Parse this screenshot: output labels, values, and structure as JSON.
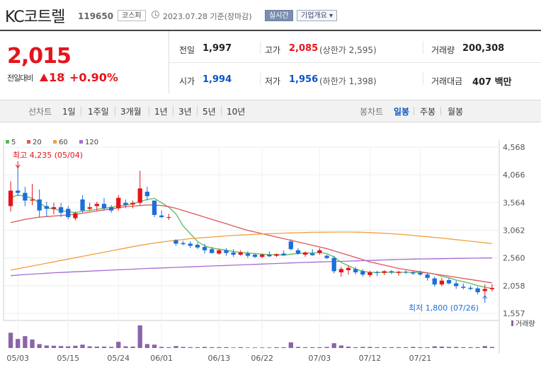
{
  "header": {
    "name": "KC코트렐",
    "code": "119650",
    "market": "코스피",
    "date": "2023.07.28",
    "basis": "기준(장마감)",
    "live_label": "실시간",
    "info_label": "기업개요 ▾"
  },
  "price": {
    "current": "2,015",
    "change_label": "전일대비",
    "change": "18",
    "change_pct": "+0.90%",
    "direction": "up"
  },
  "stats": {
    "prev_label": "전일",
    "prev": "1,997",
    "high_label": "고가",
    "high": "2,085",
    "upper_limit": "(상한가 2,595)",
    "volume_label": "거래량",
    "volume": "200,308",
    "open_label": "시가",
    "open": "1,994",
    "low_label": "저가",
    "low": "1,956",
    "lower_limit": "(하한가 1,398)",
    "amount_label": "거래대금",
    "amount": "407 백만"
  },
  "toolbar": {
    "line_label": "선차트",
    "line_periods": [
      "1일",
      "1주일",
      "3개월",
      "1년",
      "3년",
      "5년",
      "10년"
    ],
    "selected_line_period": "3개월",
    "candle_label": "봉차트",
    "candle_periods": [
      "일봉",
      "주봉",
      "월봉"
    ],
    "selected_candle_period": "일봉"
  },
  "colors": {
    "up": "#e5141b",
    "down": "#1c6fd8",
    "ma5": "#5cb85c",
    "ma20": "#e0545b",
    "ma60": "#f0a040",
    "ma120": "#a66bd1",
    "volume": "#8b64a8"
  },
  "chart_data": {
    "type": "candlestick",
    "moving_average_legend": [
      "5",
      "20",
      "60",
      "120"
    ],
    "yticks": [
      "4,568",
      "4,066",
      "3,564",
      "3,062",
      "2,560",
      "2,058",
      "1,557"
    ],
    "ylim": [
      1557,
      4568
    ],
    "xticks": [
      "05/03",
      "05/15",
      "05/24",
      "06/01",
      "06/13",
      "06/22",
      "07/03",
      "07/12",
      "07/21"
    ],
    "high_annotation": "최고 4,235 (05/04)",
    "low_annotation": "최저 1,800 (07/26)",
    "volume_label": "거래량",
    "candles": [
      {
        "o": 3500,
        "h": 3950,
        "l": 3400,
        "c": 3780
      },
      {
        "o": 3780,
        "h": 4235,
        "l": 3680,
        "c": 3740
      },
      {
        "o": 3740,
        "h": 3850,
        "l": 3500,
        "c": 3600
      },
      {
        "o": 3600,
        "h": 3900,
        "l": 3520,
        "c": 3620
      },
      {
        "o": 3620,
        "h": 3800,
        "l": 3300,
        "c": 3420
      },
      {
        "o": 3500,
        "h": 3580,
        "l": 3300,
        "c": 3450
      },
      {
        "o": 3450,
        "h": 3560,
        "l": 3350,
        "c": 3480
      },
      {
        "o": 3480,
        "h": 3560,
        "l": 3300,
        "c": 3380
      },
      {
        "o": 3450,
        "h": 3500,
        "l": 3260,
        "c": 3300
      },
      {
        "o": 3280,
        "h": 3400,
        "l": 3240,
        "c": 3370
      },
      {
        "o": 3620,
        "h": 3700,
        "l": 3380,
        "c": 3420
      },
      {
        "o": 3450,
        "h": 3560,
        "l": 3420,
        "c": 3480
      },
      {
        "o": 3500,
        "h": 3580,
        "l": 3420,
        "c": 3540
      },
      {
        "o": 3540,
        "h": 3650,
        "l": 3420,
        "c": 3460
      },
      {
        "o": 3480,
        "h": 3520,
        "l": 3380,
        "c": 3420
      },
      {
        "o": 3460,
        "h": 3700,
        "l": 3420,
        "c": 3650
      },
      {
        "o": 3560,
        "h": 3620,
        "l": 3460,
        "c": 3520
      },
      {
        "o": 3530,
        "h": 3600,
        "l": 3460,
        "c": 3560
      },
      {
        "o": 3560,
        "h": 4140,
        "l": 3520,
        "c": 3820
      },
      {
        "o": 3760,
        "h": 3850,
        "l": 3600,
        "c": 3680
      },
      {
        "o": 3600,
        "h": 3600,
        "l": 3300,
        "c": 3340
      },
      {
        "o": 3330,
        "h": 3420,
        "l": 3280,
        "c": 3300
      },
      {
        "o": 3300,
        "h": 3360,
        "l": 3250,
        "c": 3300
      },
      {
        "o": 2880,
        "h": 2900,
        "l": 2780,
        "c": 2820
      },
      {
        "o": 2830,
        "h": 2870,
        "l": 2790,
        "c": 2810
      },
      {
        "o": 2820,
        "h": 2860,
        "l": 2740,
        "c": 2780
      },
      {
        "o": 2800,
        "h": 2840,
        "l": 2720,
        "c": 2750
      },
      {
        "o": 2760,
        "h": 2820,
        "l": 2640,
        "c": 2700
      },
      {
        "o": 2720,
        "h": 2760,
        "l": 2640,
        "c": 2650
      },
      {
        "o": 2640,
        "h": 2720,
        "l": 2620,
        "c": 2700
      },
      {
        "o": 2700,
        "h": 2740,
        "l": 2600,
        "c": 2650
      },
      {
        "o": 2660,
        "h": 2720,
        "l": 2580,
        "c": 2620
      },
      {
        "o": 2620,
        "h": 2700,
        "l": 2600,
        "c": 2660
      },
      {
        "o": 2640,
        "h": 2680,
        "l": 2560,
        "c": 2600
      },
      {
        "o": 2620,
        "h": 2650,
        "l": 2560,
        "c": 2580
      },
      {
        "o": 2580,
        "h": 2640,
        "l": 2560,
        "c": 2620
      },
      {
        "o": 2620,
        "h": 2680,
        "l": 2580,
        "c": 2590
      },
      {
        "o": 2600,
        "h": 2640,
        "l": 2580,
        "c": 2630
      },
      {
        "o": 2640,
        "h": 2700,
        "l": 2600,
        "c": 2610
      },
      {
        "o": 2860,
        "h": 2900,
        "l": 2700,
        "c": 2720
      },
      {
        "o": 2700,
        "h": 2740,
        "l": 2620,
        "c": 2640
      },
      {
        "o": 2620,
        "h": 2680,
        "l": 2580,
        "c": 2660
      },
      {
        "o": 2640,
        "h": 2720,
        "l": 2600,
        "c": 2610
      },
      {
        "o": 2650,
        "h": 2740,
        "l": 2620,
        "c": 2700
      },
      {
        "o": 2600,
        "h": 2620,
        "l": 2540,
        "c": 2560
      },
      {
        "o": 2560,
        "h": 2600,
        "l": 2280,
        "c": 2320
      },
      {
        "o": 2300,
        "h": 2400,
        "l": 2220,
        "c": 2360
      },
      {
        "o": 2340,
        "h": 2420,
        "l": 2260,
        "c": 2380
      },
      {
        "o": 2360,
        "h": 2400,
        "l": 2260,
        "c": 2300
      },
      {
        "o": 2320,
        "h": 2360,
        "l": 2220,
        "c": 2260
      },
      {
        "o": 2250,
        "h": 2330,
        "l": 2210,
        "c": 2300
      },
      {
        "o": 2300,
        "h": 2330,
        "l": 2230,
        "c": 2290
      },
      {
        "o": 2290,
        "h": 2340,
        "l": 2250,
        "c": 2320
      },
      {
        "o": 2320,
        "h": 2340,
        "l": 2270,
        "c": 2300
      },
      {
        "o": 2290,
        "h": 2330,
        "l": 2240,
        "c": 2310
      },
      {
        "o": 2310,
        "h": 2340,
        "l": 2270,
        "c": 2300
      },
      {
        "o": 2300,
        "h": 2320,
        "l": 2250,
        "c": 2280
      },
      {
        "o": 2290,
        "h": 2330,
        "l": 2240,
        "c": 2260
      },
      {
        "o": 2260,
        "h": 2290,
        "l": 2150,
        "c": 2200
      },
      {
        "o": 2190,
        "h": 2220,
        "l": 2040,
        "c": 2080
      },
      {
        "o": 2080,
        "h": 2200,
        "l": 2050,
        "c": 2150
      },
      {
        "o": 2160,
        "h": 2200,
        "l": 2080,
        "c": 2100
      },
      {
        "o": 2100,
        "h": 2150,
        "l": 2000,
        "c": 2050
      },
      {
        "o": 2040,
        "h": 2100,
        "l": 1990,
        "c": 2020
      },
      {
        "o": 2020,
        "h": 2060,
        "l": 1980,
        "c": 2000
      },
      {
        "o": 2010,
        "h": 2040,
        "l": 1900,
        "c": 1940
      },
      {
        "o": 1960,
        "h": 2080,
        "l": 1800,
        "c": 2000
      },
      {
        "o": 1994,
        "h": 2085,
        "l": 1956,
        "c": 2015
      }
    ],
    "volumes": [
      54,
      32,
      42,
      30,
      14,
      9,
      8,
      7,
      6,
      8,
      12,
      6,
      5,
      5,
      4,
      22,
      6,
      5,
      80,
      14,
      12,
      4,
      3,
      7,
      4,
      3,
      3,
      4,
      3,
      3,
      3,
      2,
      3,
      2,
      2,
      2,
      2,
      3,
      3,
      20,
      4,
      3,
      3,
      3,
      4,
      17,
      9,
      5,
      3,
      4,
      4,
      3,
      3,
      3,
      3,
      3,
      4,
      3,
      3,
      6,
      5,
      4,
      4,
      3,
      3,
      3,
      7,
      4
    ],
    "series": [
      {
        "name": "5",
        "values": [
          3650,
          3700,
          3680,
          3640,
          3560,
          3470,
          3450,
          3420,
          3400,
          3380,
          3410,
          3420,
          3440,
          3460,
          3480,
          3500,
          3520,
          3540,
          3580,
          3620,
          3640,
          3560,
          3480,
          3360,
          3140,
          3000,
          2860,
          2780,
          2740,
          2720,
          2700,
          2680,
          2660,
          2650,
          2640,
          2630,
          2620,
          2620,
          2610,
          2630,
          2640,
          2650,
          2650,
          2660,
          2640,
          2580,
          2480,
          2420,
          2360,
          2320,
          2300,
          2300,
          2300,
          2300,
          2300,
          2300,
          2300,
          2300,
          2290,
          2270,
          2230,
          2200,
          2160,
          2130,
          2100,
          2060,
          2030,
          2010
        ]
      },
      {
        "name": "20",
        "values": [
          3200,
          3230,
          3260,
          3280,
          3300,
          3310,
          3320,
          3330,
          3340,
          3350,
          3370,
          3390,
          3410,
          3430,
          3450,
          3470,
          3490,
          3500,
          3510,
          3520,
          3520,
          3510,
          3490,
          3460,
          3420,
          3380,
          3340,
          3300,
          3260,
          3220,
          3180,
          3140,
          3100,
          3060,
          3030,
          3000,
          2970,
          2940,
          2910,
          2880,
          2850,
          2820,
          2790,
          2760,
          2730,
          2690,
          2650,
          2610,
          2570,
          2530,
          2490,
          2460,
          2430,
          2400,
          2370,
          2350,
          2330,
          2310,
          2290,
          2270,
          2250,
          2230,
          2210,
          2190,
          2170,
          2150,
          2130,
          2110
        ]
      },
      {
        "name": "60",
        "values": [
          2340,
          2365,
          2390,
          2415,
          2440,
          2465,
          2490,
          2515,
          2540,
          2565,
          2590,
          2615,
          2640,
          2665,
          2690,
          2715,
          2740,
          2765,
          2790,
          2810,
          2830,
          2850,
          2865,
          2880,
          2895,
          2910,
          2920,
          2930,
          2940,
          2950,
          2960,
          2968,
          2975,
          2982,
          2988,
          2994,
          3000,
          3005,
          3010,
          3014,
          3018,
          3022,
          3025,
          3027,
          3028,
          3029,
          3030,
          3030,
          3028,
          3025,
          3020,
          3014,
          3008,
          3000,
          2990,
          2980,
          2968,
          2956,
          2944,
          2932,
          2920,
          2906,
          2892,
          2878,
          2864,
          2850,
          2835,
          2820
        ]
      },
      {
        "name": "120",
        "values": [
          2240,
          2250,
          2260,
          2268,
          2276,
          2284,
          2292,
          2298,
          2304,
          2310,
          2316,
          2322,
          2328,
          2334,
          2340,
          2346,
          2352,
          2358,
          2364,
          2370,
          2375,
          2380,
          2385,
          2390,
          2395,
          2400,
          2405,
          2410,
          2415,
          2420,
          2425,
          2430,
          2435,
          2440,
          2445,
          2450,
          2455,
          2460,
          2465,
          2470,
          2475,
          2480,
          2484,
          2488,
          2492,
          2496,
          2500,
          2504,
          2508,
          2512,
          2516,
          2520,
          2524,
          2528,
          2532,
          2536,
          2540,
          2542,
          2544,
          2546,
          2548,
          2550,
          2552,
          2554,
          2556,
          2558,
          2560,
          2560
        ]
      }
    ]
  }
}
